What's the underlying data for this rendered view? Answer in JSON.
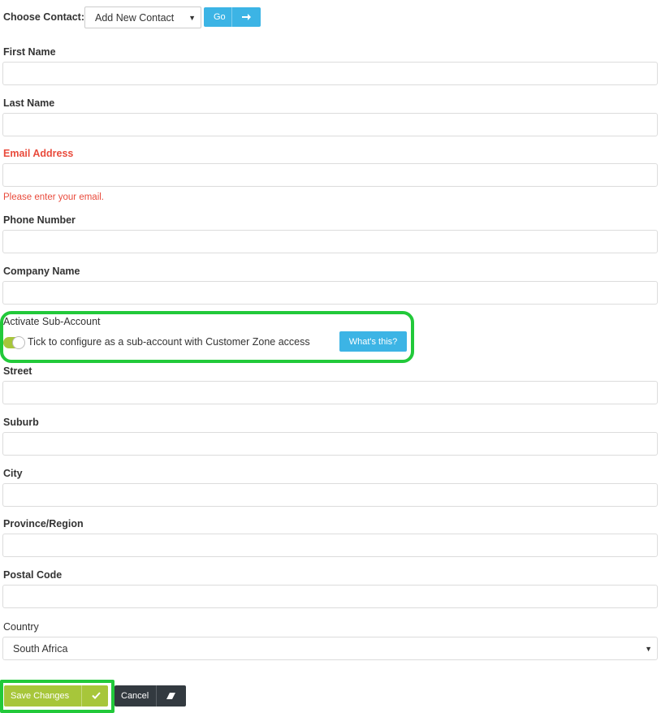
{
  "header": {
    "choose_label": "Choose Contact:",
    "contact_select": "Add New Contact",
    "go_label": "Go"
  },
  "fields": {
    "first_name": "First Name",
    "last_name": "Last Name",
    "email": "Email Address",
    "email_error": "Please enter your email.",
    "phone": "Phone Number",
    "company": "Company Name",
    "street": "Street",
    "suburb": "Suburb",
    "city": "City",
    "province": "Province/Region",
    "postal": "Postal Code",
    "country": "Country",
    "country_value": "South Africa"
  },
  "sub_account": {
    "label": "Activate Sub-Account",
    "toggle_text": "Tick to configure as a sub-account with Customer Zone access",
    "help_button": "What's this?",
    "enabled": true
  },
  "actions": {
    "save": "Save Changes",
    "cancel": "Cancel"
  },
  "colors": {
    "error": "#e94b3c",
    "accent_blue": "#3cb4e5",
    "save_green": "#a7c63a",
    "cancel_dark": "#333a40",
    "highlight": "#22c93a"
  }
}
